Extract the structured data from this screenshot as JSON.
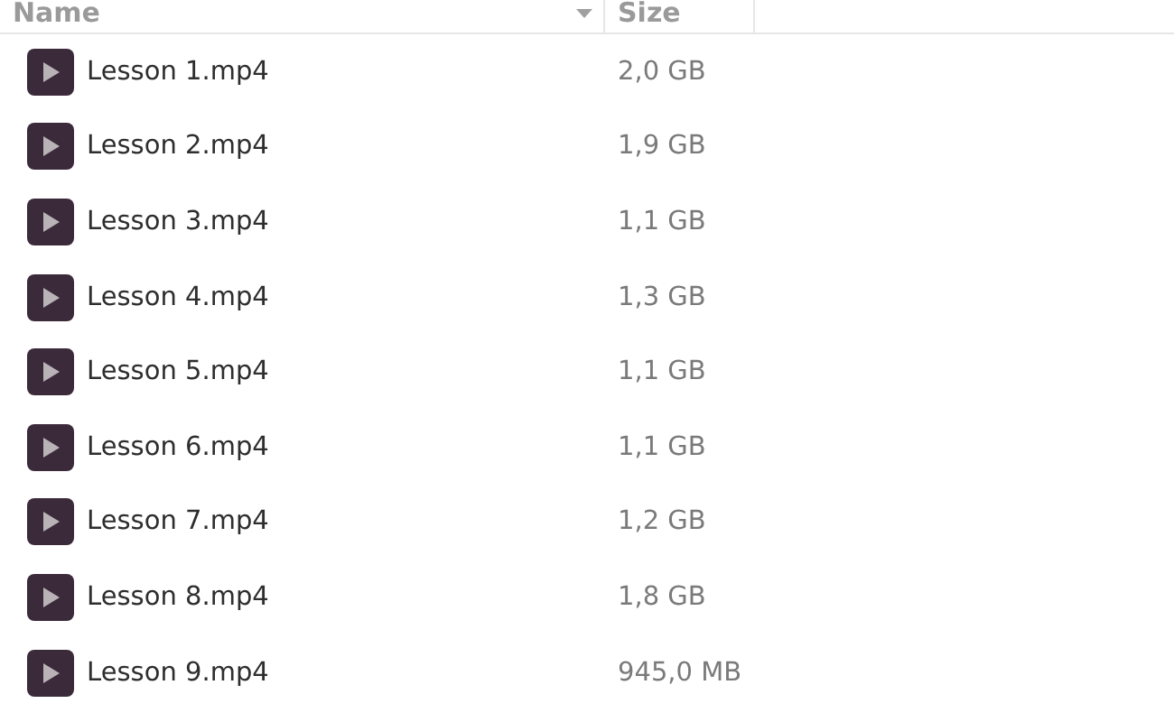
{
  "table": {
    "columns": [
      {
        "label": "Name",
        "sorted": true
      },
      {
        "label": "Size",
        "sorted": false
      }
    ],
    "rows": [
      {
        "name": "Lesson 1.mp4",
        "size": "2,0 GB"
      },
      {
        "name": "Lesson 2.mp4",
        "size": "1,9 GB"
      },
      {
        "name": "Lesson 3.mp4",
        "size": "1,1 GB"
      },
      {
        "name": "Lesson 4.mp4",
        "size": "1,3 GB"
      },
      {
        "name": "Lesson 5.mp4",
        "size": "1,1 GB"
      },
      {
        "name": "Lesson 6.mp4",
        "size": "1,1 GB"
      },
      {
        "name": "Lesson 7.mp4",
        "size": "1,2 GB"
      },
      {
        "name": "Lesson 8.mp4",
        "size": "1,8 GB"
      },
      {
        "name": "Lesson 9.mp4",
        "size": "945,0 MB"
      }
    ]
  }
}
